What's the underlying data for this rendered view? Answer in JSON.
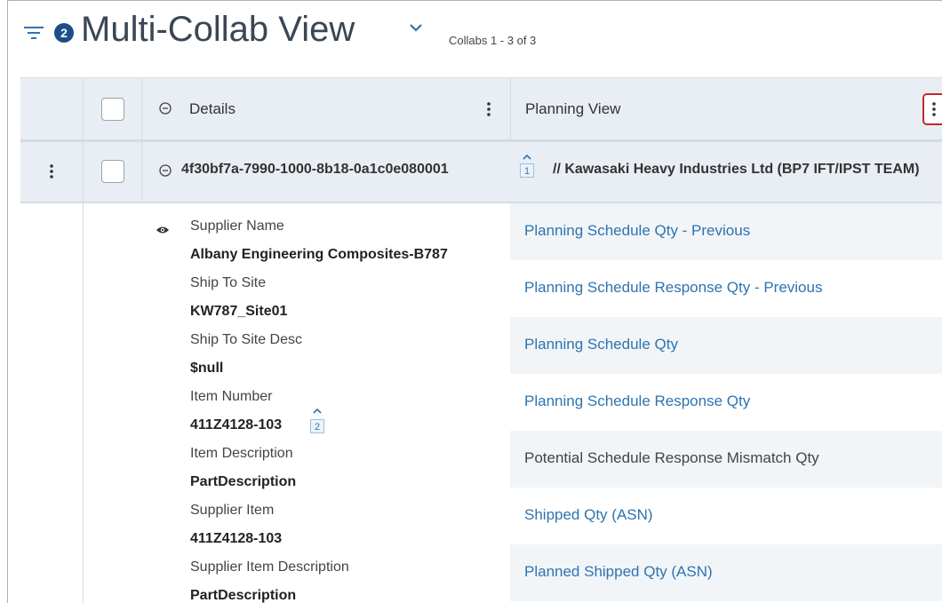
{
  "header": {
    "filter_badge": "2",
    "title": "Multi-Collab View",
    "collab_count": "Collabs 1 - 3 of 3"
  },
  "columns": {
    "details": "Details",
    "planning_view": "Planning View"
  },
  "group": {
    "collab_id": "4f30bf7a-7990-1000-8b18-0a1c0e080001",
    "id_badge": "1",
    "name": "// Kawasaki Heavy Industries Ltd (BP7 IFT/IPST TEAM)"
  },
  "details": [
    {
      "label": "Supplier Name",
      "value": "Albany Engineering Composites-B787"
    },
    {
      "label": "Ship To Site",
      "value": "KW787_Site01"
    },
    {
      "label": "Ship To Site Desc",
      "value": "$null"
    },
    {
      "label": "Item Number",
      "value": "411Z4128-103",
      "badge": "2"
    },
    {
      "label": "Item Description",
      "value": "PartDescription"
    },
    {
      "label": "Supplier Item",
      "value": "411Z4128-103"
    },
    {
      "label": "Supplier Item Description",
      "value": "PartDescription"
    }
  ],
  "planning_rows": [
    {
      "label": "Planning Schedule Qty - Previous",
      "link": true
    },
    {
      "label": "Planning Schedule Response Qty - Previous",
      "link": true
    },
    {
      "label": "Planning Schedule Qty",
      "link": true
    },
    {
      "label": "Planning Schedule Response Qty",
      "link": true
    },
    {
      "label": "Potential Schedule Response Mismatch Qty",
      "link": false
    },
    {
      "label": "Shipped Qty (ASN)",
      "link": true
    },
    {
      "label": "Planned Shipped Qty (ASN)",
      "link": true
    }
  ],
  "colors": {
    "link": "#2f73b0",
    "badge": "#1d4e89",
    "highlight": "#c0282d",
    "header_bg": "#e8eef3"
  }
}
